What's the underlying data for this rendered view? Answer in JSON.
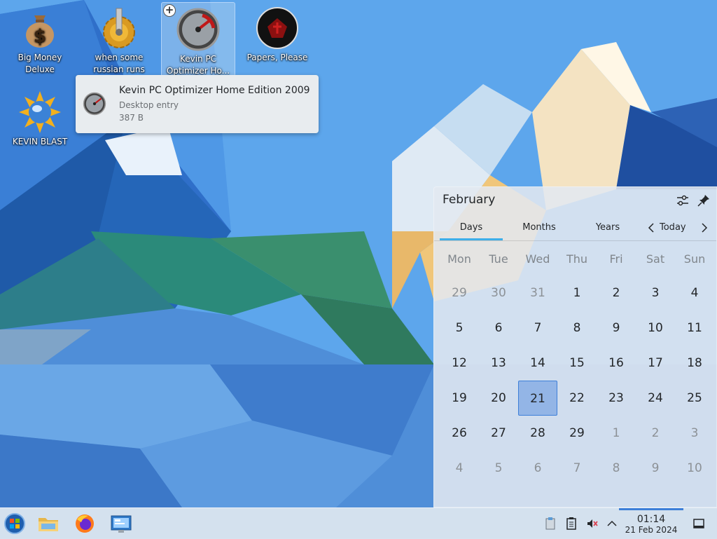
{
  "desktop": {
    "icons": [
      {
        "label": "Big Money Deluxe",
        "icon": "money-bag-icon"
      },
      {
        "label": "when some russian runs a...",
        "icon": "gear-cog-icon"
      },
      {
        "label": "Kevin PC Optimizer Ho...",
        "icon": "speedometer-icon"
      },
      {
        "label": "Papers, Please",
        "icon": "papers-please-seal-icon"
      },
      {
        "label": "KEVIN BLAST",
        "icon": "sun-globe-icon"
      }
    ]
  },
  "tooltip": {
    "title": "Kevin PC Optimizer Home Edition 2009",
    "type": "Desktop entry",
    "size": "387 B"
  },
  "calendar": {
    "title": "February",
    "tabs": [
      "Days",
      "Months",
      "Years"
    ],
    "today_label": "Today",
    "weekdays": [
      "Mon",
      "Tue",
      "Wed",
      "Thu",
      "Fri",
      "Sat",
      "Sun"
    ],
    "weeks": [
      [
        "29",
        "30",
        "31",
        "1",
        "2",
        "3",
        "4"
      ],
      [
        "5",
        "6",
        "7",
        "8",
        "9",
        "10",
        "11"
      ],
      [
        "12",
        "13",
        "14",
        "15",
        "16",
        "17",
        "18"
      ],
      [
        "19",
        "20",
        "21",
        "22",
        "23",
        "24",
        "25"
      ],
      [
        "26",
        "27",
        "28",
        "29",
        "1",
        "2",
        "3"
      ],
      [
        "4",
        "5",
        "6",
        "7",
        "8",
        "9",
        "10"
      ]
    ],
    "selected_day": "21"
  },
  "taskbar": {
    "items": [
      "start-menu-icon",
      "file-manager-icon",
      "firefox-icon",
      "system-settings-icon"
    ],
    "tray": [
      "clipboard-icon",
      "notes-icon",
      "volume-muted-icon",
      "tray-expand-icon"
    ],
    "time": "01:14",
    "date": "21 Feb 2024"
  },
  "colors": {
    "accent": "#3d7fd8",
    "highlight": "#93b5e6",
    "panel": "#e0e8f0"
  }
}
